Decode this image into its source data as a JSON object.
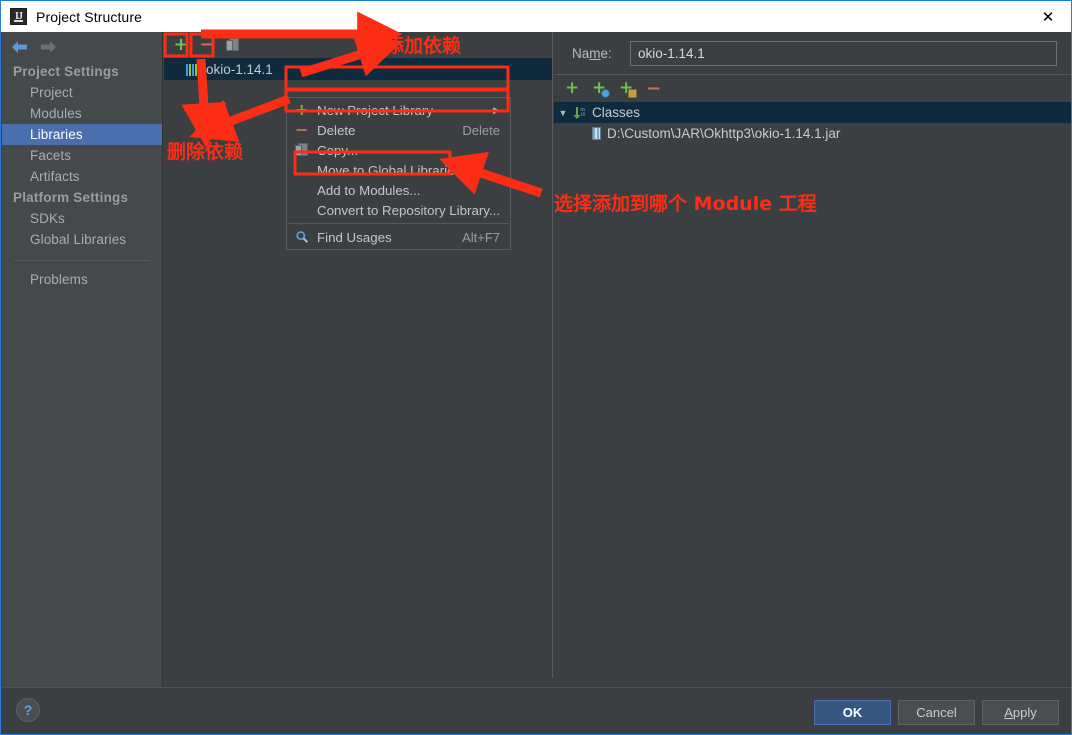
{
  "window": {
    "title": "Project Structure",
    "app_icon": "intellij-idea-icon",
    "close_label": "✕"
  },
  "sidebar": {
    "nav_buttons": [
      {
        "name": "back-arrow-icon",
        "label": "◀"
      },
      {
        "name": "forward-arrow-icon",
        "label": "▶"
      }
    ],
    "groups": [
      {
        "label": "Project Settings",
        "items": [
          {
            "label": "Project",
            "selected": false
          },
          {
            "label": "Modules",
            "selected": false
          },
          {
            "label": "Libraries",
            "selected": true
          },
          {
            "label": "Facets",
            "selected": false
          },
          {
            "label": "Artifacts",
            "selected": false
          }
        ]
      },
      {
        "label": "Platform Settings",
        "items": [
          {
            "label": "SDKs",
            "selected": false
          },
          {
            "label": "Global Libraries",
            "selected": false
          }
        ]
      }
    ],
    "extra_items": [
      {
        "label": "Problems"
      }
    ]
  },
  "middle": {
    "toolbar": [
      {
        "name": "add-library-button",
        "glyph": "+"
      },
      {
        "name": "remove-library-button",
        "glyph": "−"
      },
      {
        "name": "copy-library-button",
        "glyph": "copy-icon"
      }
    ],
    "library_item": {
      "label": "okio-1.14.1",
      "icon": "jar-library-icon"
    }
  },
  "context_menu": {
    "items": [
      {
        "label": "New Project Library",
        "accel": "",
        "icon": "plus-icon",
        "submenu": "▶"
      },
      {
        "label": "Delete",
        "accel": "Delete",
        "icon": "minus-icon",
        "submenu": ""
      },
      {
        "label": "Copy...",
        "accel": "",
        "icon": "copy-icon",
        "submenu": ""
      },
      {
        "label": "Move to Global Libraries...",
        "accel": "",
        "icon": "",
        "submenu": ""
      },
      {
        "label": "Add to Modules...",
        "accel": "",
        "icon": "",
        "submenu": ""
      },
      {
        "label": "Convert to Repository Library...",
        "accel": "",
        "icon": "",
        "submenu": ""
      },
      {
        "label": "Find Usages",
        "accel": "Alt+F7",
        "icon": "search-icon",
        "submenu": ""
      }
    ]
  },
  "right": {
    "name_label": "Name:",
    "name_label_pre": "Na",
    "name_label_mnemonic": "m",
    "name_label_post": "e:",
    "name_value": "okio-1.14.1",
    "name_placeholder": "",
    "toolbar": [
      {
        "name": "add-classes-button",
        "glyph": "+"
      },
      {
        "name": "add-remote-library-button",
        "glyph": "+"
      },
      {
        "name": "add-module-library-button",
        "glyph": "+"
      },
      {
        "name": "remove-entry-button",
        "glyph": "−"
      }
    ],
    "tree": {
      "root": {
        "label": "Classes",
        "icon": "classes-root-icon",
        "expander": "▼"
      },
      "children": [
        {
          "label": "D:\\Custom\\JAR\\Okhttp3\\okio-1.14.1.jar",
          "icon": "jar-file-icon"
        }
      ]
    }
  },
  "footer": {
    "help_label": "?",
    "buttons": [
      {
        "label": "OK",
        "primary": true
      },
      {
        "label": "Cancel",
        "primary": false
      },
      {
        "label": "Apply",
        "primary": false,
        "mnemonic": "A"
      }
    ]
  },
  "annotations": {
    "accent_color": "#fb2d14",
    "texts": [
      {
        "id": "add-dependency",
        "text": "添加依赖"
      },
      {
        "id": "remove-dependency",
        "text": "删除依赖"
      },
      {
        "id": "choose-module",
        "text": "选择添加到哪个 Module 工程"
      }
    ]
  },
  "colors": {
    "selection_blue": "#4b6eaf",
    "panel_bg": "#3c3f41",
    "sidebar_bg": "#45494a",
    "tree_selection": "#0f2b3d",
    "green": "#6fbf50",
    "red": "#cf6a5a",
    "annotation": "#fb2d14"
  }
}
